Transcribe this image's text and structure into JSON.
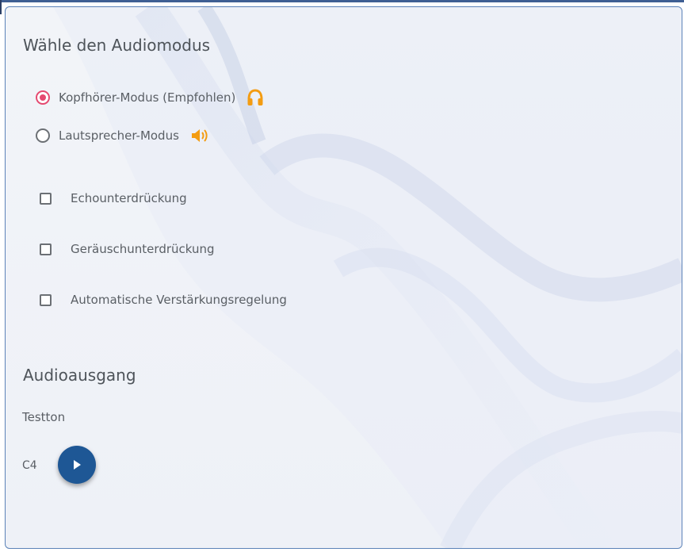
{
  "audio_mode": {
    "title": "Wähle den Audiomodus",
    "options": [
      {
        "label": "Kopfhörer-Modus (Empfohlen)",
        "checked": true,
        "icon": "headphones-icon"
      },
      {
        "label": "Lautsprecher-Modus",
        "checked": false,
        "icon": "speaker-icon"
      }
    ],
    "checkboxes": [
      {
        "label": "Echounterdrückung",
        "checked": false
      },
      {
        "label": "Geräuschunterdrückung",
        "checked": false
      },
      {
        "label": "Automatische Verstärkungsregelung",
        "checked": false
      }
    ]
  },
  "audio_output": {
    "title": "Audioausgang",
    "test_tone_label": "Testton",
    "note": "C4",
    "play_icon": "play-icon"
  },
  "colors": {
    "accent_radio": "#e54970",
    "icon_orange": "#f39c12",
    "play_button": "#1e5795",
    "border": "#5b82b8"
  }
}
